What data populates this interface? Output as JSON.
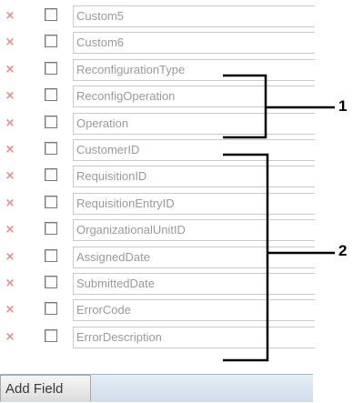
{
  "fields": [
    {
      "name": "Custom5"
    },
    {
      "name": "Custom6"
    },
    {
      "name": "ReconfigurationType"
    },
    {
      "name": "ReconfigOperation"
    },
    {
      "name": "Operation"
    },
    {
      "name": "CustomerID"
    },
    {
      "name": "RequisitionID"
    },
    {
      "name": "RequisitionEntryID"
    },
    {
      "name": "OrganizationalUnitID"
    },
    {
      "name": "AssignedDate"
    },
    {
      "name": "SubmittedDate"
    },
    {
      "name": "ErrorCode"
    },
    {
      "name": "ErrorDescription"
    }
  ],
  "add_field_label": "Add Field",
  "callouts": [
    {
      "label": "1"
    },
    {
      "label": "2"
    }
  ],
  "colors": {
    "delete_icon": "#e88a86",
    "field_text": "#9a9a9a",
    "tab_bar": "#cfdcea"
  },
  "icons": {
    "delete": "x-delete-icon"
  }
}
